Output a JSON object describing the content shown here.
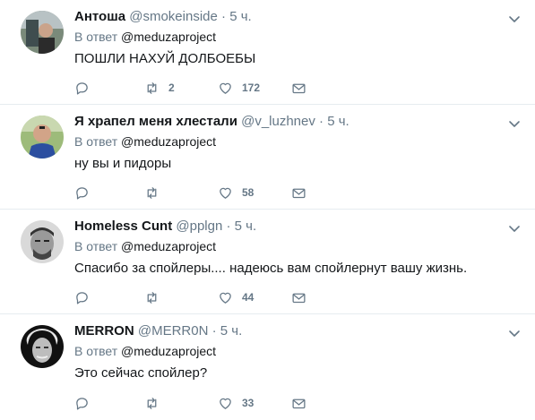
{
  "reply_prefix": "В ответ",
  "tweets": [
    {
      "name": "Антоша",
      "handle": "@smokeinside",
      "dot": "·",
      "time": "5 ч.",
      "reply_to": "@meduzaproject",
      "text": "ПОШЛИ НАХУЙ ДОЛБОЕБЫ",
      "replies": "",
      "retweets": "2",
      "likes": "172"
    },
    {
      "name": "Я храпел меня хлестали",
      "handle": "@v_luzhnev",
      "dot": "·",
      "time": "5 ч.",
      "reply_to": "@meduzaproject",
      "text": "ну вы и пидоры",
      "replies": "",
      "retweets": "",
      "likes": "58"
    },
    {
      "name": "Homeless Cunt",
      "handle": "@pplgn",
      "dot": "·",
      "time": "5 ч.",
      "reply_to": "@meduzaproject",
      "text": "Спасибо за спойлеры.... надеюсь вам спойлернут вашу жизнь.",
      "replies": "",
      "retweets": "",
      "likes": "44"
    },
    {
      "name": "MERRON",
      "handle": "@MERR0N",
      "dot": "·",
      "time": "5 ч.",
      "reply_to": "@meduzaproject",
      "text": "Это сейчас спойлер?",
      "replies": "",
      "retweets": "",
      "likes": "33"
    }
  ],
  "icons": {
    "reply": "reply-icon",
    "retweet": "retweet-icon",
    "like": "heart-icon",
    "dm": "envelope-icon",
    "more": "chevron-down-icon"
  },
  "colors": {
    "text": "#14171a",
    "muted": "#657786",
    "border": "#e6ecf0"
  }
}
